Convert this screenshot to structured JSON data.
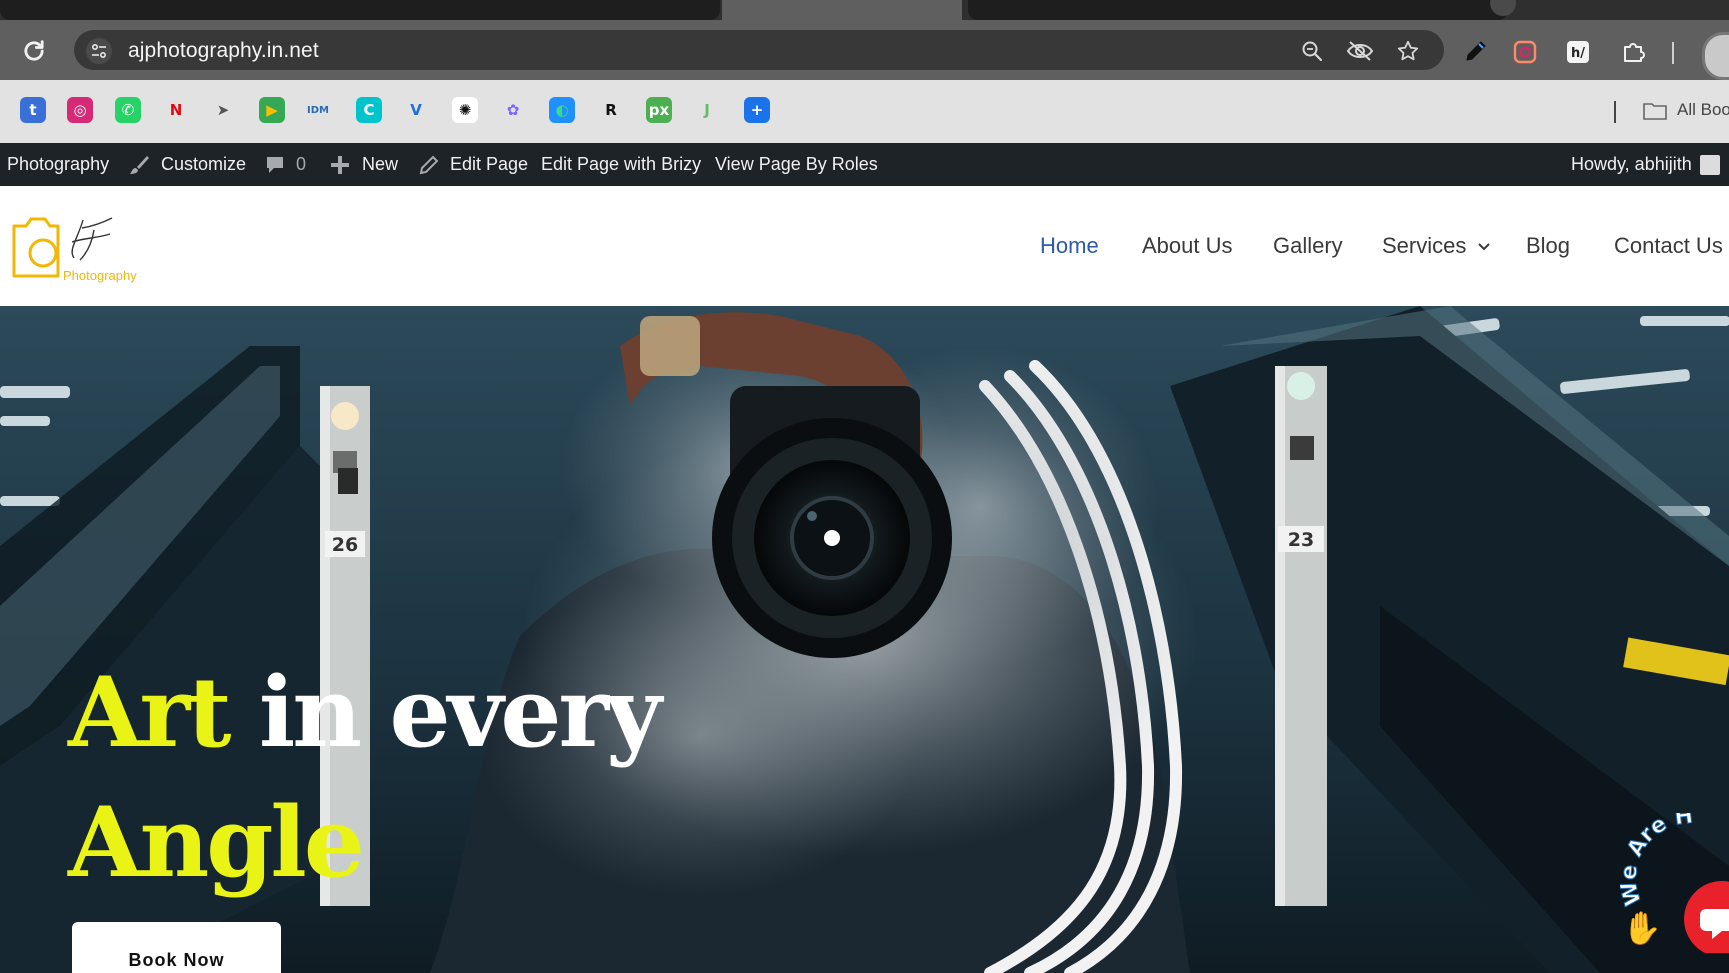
{
  "browser": {
    "url": "ajphotography.in.net",
    "bookmarks_bar": {
      "all_bookmarks_label": "All Boo",
      "items": [
        {
          "icon": "tumblr-icon",
          "glyph": "t",
          "bg": "#3a6fd8",
          "fg": "#ffffff"
        },
        {
          "icon": "instagram-icon",
          "glyph": "◎",
          "bg": "#d62976",
          "fg": "#ffffff"
        },
        {
          "icon": "whatsapp-icon",
          "glyph": "✆",
          "bg": "#25d366",
          "fg": "#ffffff"
        },
        {
          "icon": "netflix-icon",
          "glyph": "N",
          "bg": "transparent",
          "fg": "#e50914"
        },
        {
          "icon": "bird-icon",
          "glyph": "➤",
          "bg": "transparent",
          "fg": "#555555"
        },
        {
          "icon": "google-meet-icon",
          "glyph": "▶",
          "bg": "#34a853",
          "fg": "#fbbc04"
        },
        {
          "icon": "idm-icon",
          "glyph": "IDM",
          "bg": "transparent",
          "fg": "#2b6cb0"
        },
        {
          "icon": "canva-icon",
          "glyph": "C",
          "bg": "#00c4cc",
          "fg": "#ffffff"
        },
        {
          "icon": "vector-icon",
          "glyph": "V",
          "bg": "transparent",
          "fg": "#1e6fd9"
        },
        {
          "icon": "chatgpt-icon",
          "glyph": "✺",
          "bg": "#ffffff",
          "fg": "#111111"
        },
        {
          "icon": "copilot-icon",
          "glyph": "✿",
          "bg": "transparent",
          "fg": "#7b61ff"
        },
        {
          "icon": "edge-icon",
          "glyph": "◐",
          "bg": "#1e90ff",
          "fg": "#3ddc84"
        },
        {
          "icon": "r-icon",
          "glyph": "R",
          "bg": "transparent",
          "fg": "#111111"
        },
        {
          "icon": "pixlr-icon",
          "glyph": "px",
          "bg": "#4caf50",
          "fg": "#ffffff"
        },
        {
          "icon": "jasper-icon",
          "glyph": "J",
          "bg": "transparent",
          "fg": "#66bb6a"
        },
        {
          "icon": "sparkle-icon",
          "glyph": "+",
          "bg": "#1a73e8",
          "fg": "#ffffff"
        }
      ]
    }
  },
  "admin_bar": {
    "site_name": "Photography",
    "customize": "Customize",
    "comments_count": "0",
    "new": "New",
    "edit_page": "Edit Page",
    "edit_with_brizy": "Edit Page with Brizy",
    "view_by_roles": "View Page By Roles",
    "howdy": "Howdy, abhijith"
  },
  "site": {
    "logo_text": "Photography",
    "nav": [
      {
        "label": "Home",
        "active": true
      },
      {
        "label": "About Us",
        "active": false
      },
      {
        "label": "Gallery",
        "active": false
      },
      {
        "label": "Services",
        "active": false,
        "has_dropdown": true
      },
      {
        "label": "Blog",
        "active": false
      },
      {
        "label": "Contact Us",
        "active": false
      }
    ]
  },
  "hero": {
    "headline_word_1": "Art",
    "headline_word_2": "in every",
    "headline_word_3": "Angle",
    "cta_label": "Book Now",
    "badge_text": "We Are H",
    "escalator_left_number": "26",
    "escalator_right_number": "23",
    "accent_color": "#e9f316"
  }
}
